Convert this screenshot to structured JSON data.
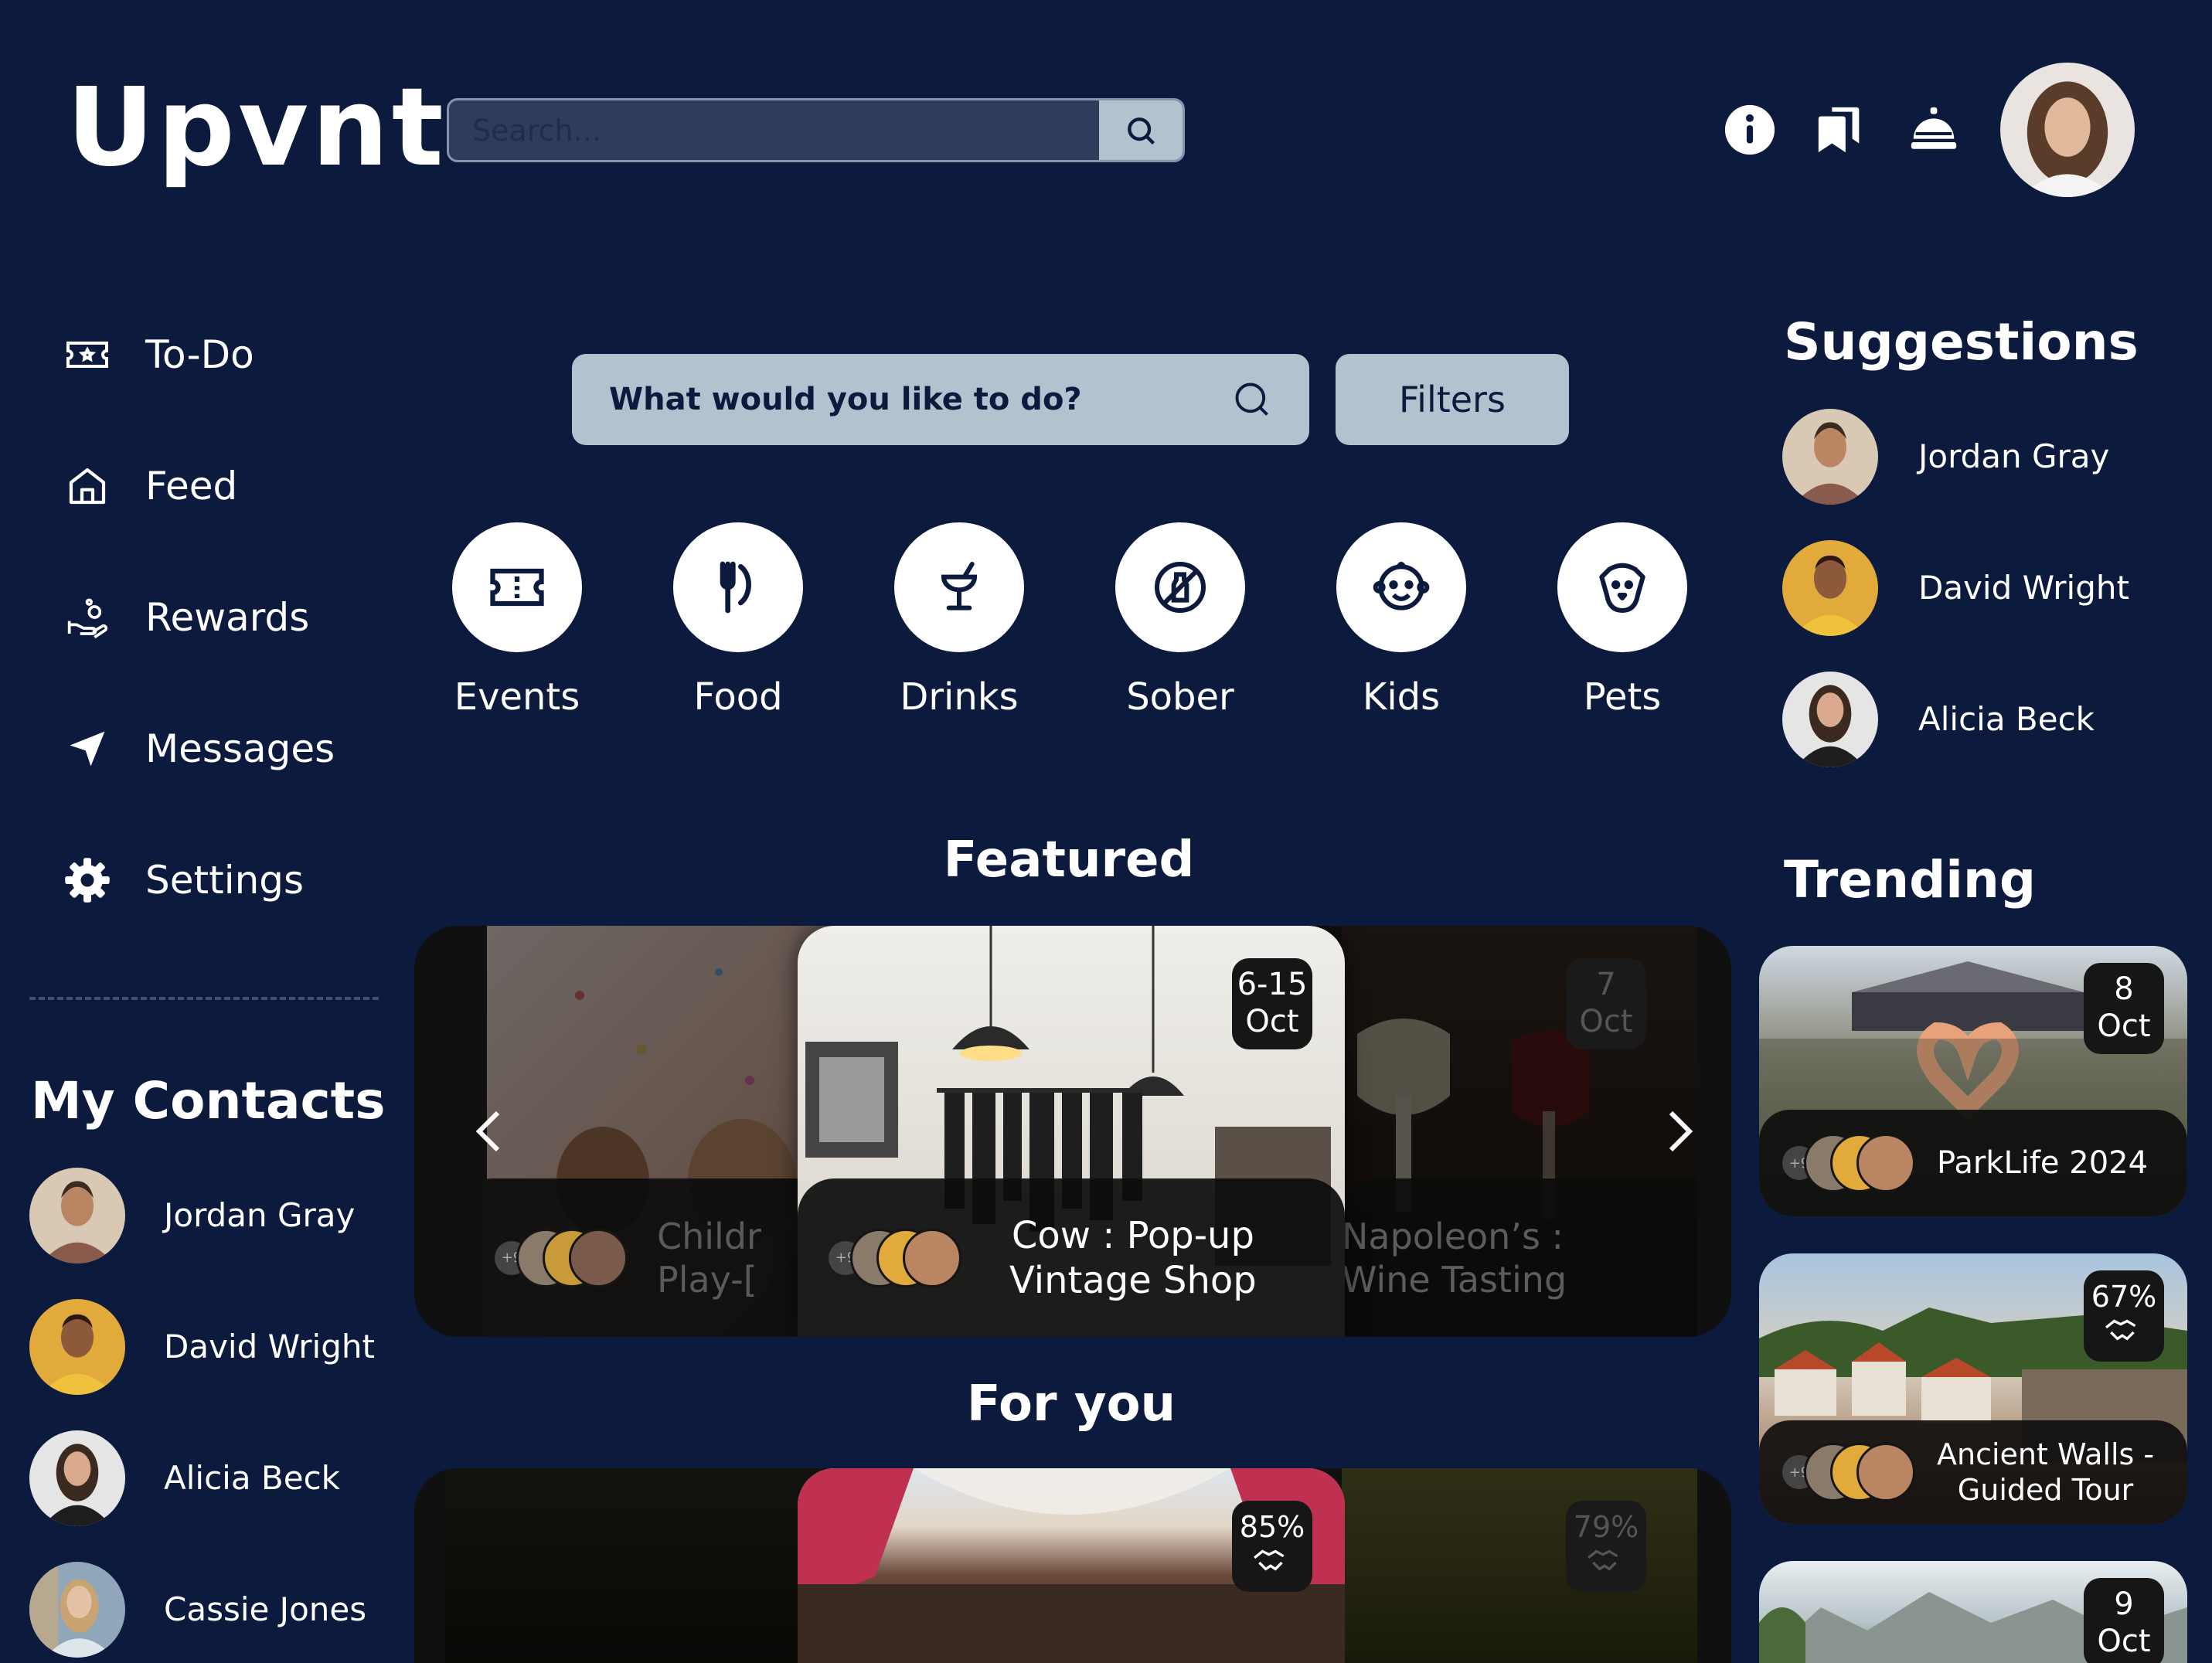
{
  "app": {
    "logo": "Upvnt"
  },
  "header": {
    "search_placeholder": "Search...",
    "icons": [
      "info-icon",
      "bookmarks-icon",
      "concierge-bell-icon"
    ]
  },
  "sidebar": {
    "nav": [
      {
        "label": "To-Do",
        "icon": "ticket-icon"
      },
      {
        "label": "Feed",
        "icon": "home-icon"
      },
      {
        "label": "Rewards",
        "icon": "rewards-icon"
      },
      {
        "label": "Messages",
        "icon": "send-icon"
      },
      {
        "label": "Settings",
        "icon": "gear-icon"
      }
    ],
    "contacts_title": "My Contacts",
    "contacts": [
      "Jordan Gray",
      "David Wright",
      "Alicia Beck",
      "Cassie Jones"
    ]
  },
  "main": {
    "search_placeholder": "What would you like to do?",
    "filters_label": "Filters",
    "categories": [
      "Events",
      "Food",
      "Drinks",
      "Sober",
      "Kids",
      "Pets"
    ],
    "featured_title": "Featured",
    "featured": [
      {
        "title_line1": "Childr",
        "title_line2": "Play-["
      },
      {
        "title_line1": "Cow : Pop-up",
        "title_line2": "Vintage Shop",
        "date_top": "6-15",
        "date_bottom": "Oct"
      },
      {
        "title_line1": "Napoleon’s :",
        "title_line2": "Wine Tasting",
        "date_top": "7",
        "date_bottom": "Oct"
      }
    ],
    "foryou_title": "For you",
    "foryou": [
      {
        "match": "85%"
      },
      {
        "match": "79%"
      }
    ],
    "avatar_plus": "+9"
  },
  "right": {
    "suggestions_title": "Suggestions",
    "suggestions": [
      "Jordan Gray",
      "David Wright",
      "Alicia Beck"
    ],
    "trending_title": "Trending",
    "trending": [
      {
        "title_line1": "ParkLife 2024",
        "badge_top": "8",
        "badge_bottom": "Oct"
      },
      {
        "title_line1": "Ancient Walls -",
        "title_line2": "Guided Tour",
        "badge_top": "67%"
      },
      {
        "badge_top": "9",
        "badge_bottom": "Oct"
      }
    ]
  }
}
